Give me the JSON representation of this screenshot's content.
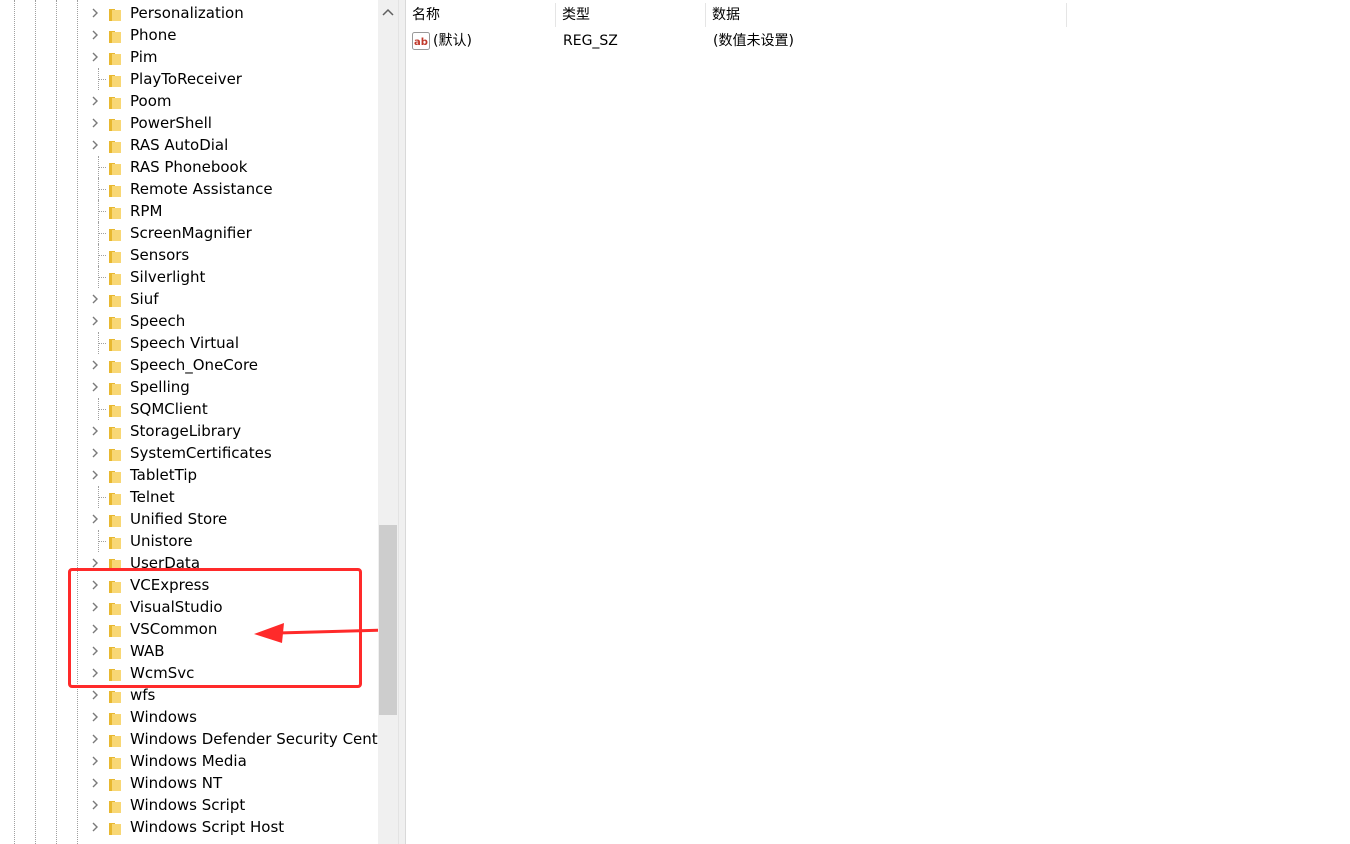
{
  "tree": {
    "items": [
      {
        "label": "Personalization",
        "expandable": true
      },
      {
        "label": "Phone",
        "expandable": true
      },
      {
        "label": "Pim",
        "expandable": true
      },
      {
        "label": "PlayToReceiver",
        "expandable": false
      },
      {
        "label": "Poom",
        "expandable": true
      },
      {
        "label": "PowerShell",
        "expandable": true
      },
      {
        "label": "RAS AutoDial",
        "expandable": true
      },
      {
        "label": "RAS Phonebook",
        "expandable": false
      },
      {
        "label": "Remote Assistance",
        "expandable": false
      },
      {
        "label": "RPM",
        "expandable": false
      },
      {
        "label": "ScreenMagnifier",
        "expandable": false
      },
      {
        "label": "Sensors",
        "expandable": false
      },
      {
        "label": "Silverlight",
        "expandable": false
      },
      {
        "label": "Siuf",
        "expandable": true
      },
      {
        "label": "Speech",
        "expandable": true
      },
      {
        "label": "Speech Virtual",
        "expandable": false
      },
      {
        "label": "Speech_OneCore",
        "expandable": true
      },
      {
        "label": "Spelling",
        "expandable": true
      },
      {
        "label": "SQMClient",
        "expandable": false
      },
      {
        "label": "StorageLibrary",
        "expandable": true
      },
      {
        "label": "SystemCertificates",
        "expandable": true
      },
      {
        "label": "TabletTip",
        "expandable": true
      },
      {
        "label": "Telnet",
        "expandable": false
      },
      {
        "label": "Unified Store",
        "expandable": true
      },
      {
        "label": "Unistore",
        "expandable": false
      },
      {
        "label": "UserData",
        "expandable": true
      },
      {
        "label": "VCExpress",
        "expandable": true
      },
      {
        "label": "VisualStudio",
        "expandable": true
      },
      {
        "label": "VSCommon",
        "expandable": true
      },
      {
        "label": "WAB",
        "expandable": true
      },
      {
        "label": "WcmSvc",
        "expandable": true
      },
      {
        "label": "wfs",
        "expandable": true
      },
      {
        "label": "Windows",
        "expandable": true
      },
      {
        "label": "Windows Defender Security Center",
        "expandable": true
      },
      {
        "label": "Windows Media",
        "expandable": true
      },
      {
        "label": "Windows NT",
        "expandable": true
      },
      {
        "label": "Windows Script",
        "expandable": true
      },
      {
        "label": "Windows Script Host",
        "expandable": true
      },
      {
        "label": "",
        "expandable": true
      }
    ]
  },
  "list": {
    "columns": {
      "name": "名称",
      "type": "类型",
      "data": "数据"
    },
    "rows": [
      {
        "icon": "string-value-icon",
        "name": "(默认)",
        "type": "REG_SZ",
        "data": "(数值未设置)"
      }
    ]
  },
  "colors": {
    "annotation": "#ff2a2a",
    "folder": "#f8d775",
    "folder_dark": "#e8b830"
  }
}
